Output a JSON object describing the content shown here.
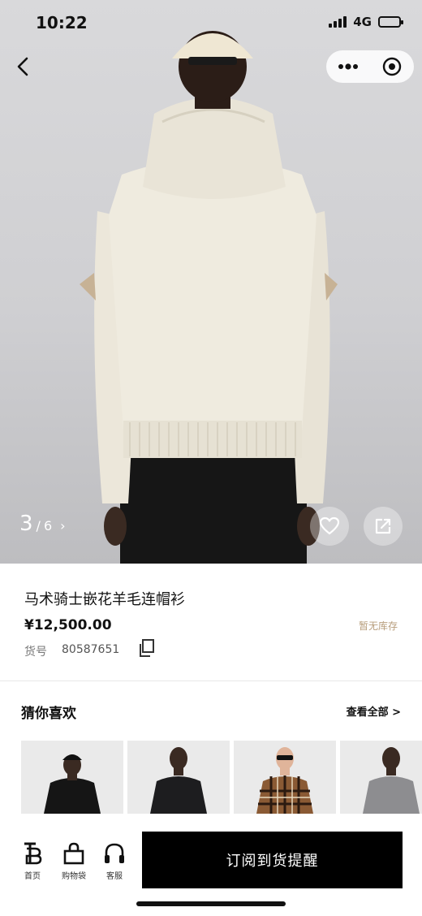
{
  "status_bar": {
    "time": "10:22",
    "network": "4G",
    "battery_level": 0.85
  },
  "gallery": {
    "current": "3",
    "separator": "/",
    "total": "6",
    "arrow": "›"
  },
  "product": {
    "name": "马术骑士嵌花羊毛连帽衫",
    "price": "¥12,500.00",
    "stock_status": "暂无库存",
    "sku_label": "货号",
    "sku_value": "80587651"
  },
  "recommend": {
    "title": "猜你喜欢",
    "more_label": "查看全部 >",
    "items": [
      {
        "icon": "black-sweater-cap"
      },
      {
        "icon": "black-sweater"
      },
      {
        "icon": "check-sweater"
      },
      {
        "icon": "grey-sweater"
      }
    ]
  },
  "bottom_nav": {
    "home_label": "首页",
    "bag_label": "购物袋",
    "service_label": "客服",
    "subscribe_label": "订阅到货提醒"
  },
  "colors": {
    "accent": "#000000",
    "stock": "#b79d7b",
    "sweater": "#efebdf"
  }
}
